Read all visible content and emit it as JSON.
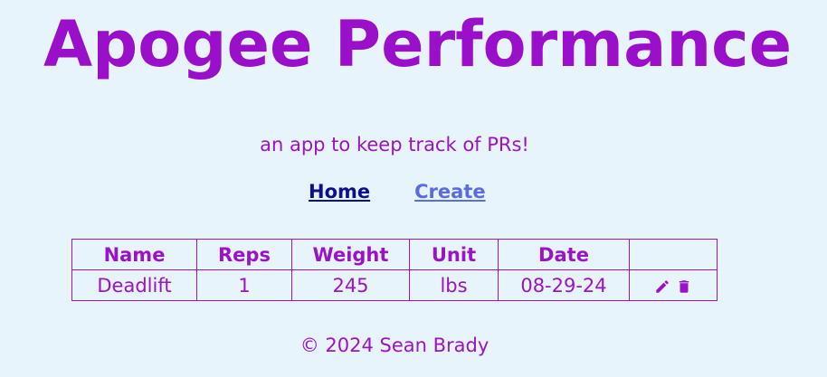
{
  "header": {
    "title": "Apogee Performance",
    "tagline": "an app to keep track of PRs!"
  },
  "nav": {
    "home_label": "Home",
    "create_label": "Create"
  },
  "table": {
    "columns": [
      "Name",
      "Reps",
      "Weight",
      "Unit",
      "Date",
      ""
    ],
    "rows": [
      {
        "name": "Deadlift",
        "reps": "1",
        "weight": "245",
        "unit": "lbs",
        "date": "08-29-24"
      }
    ],
    "row_icons": [
      "pencil-icon",
      "trash-icon"
    ]
  },
  "footer": {
    "text": "© 2024 Sean Brady"
  },
  "colors": {
    "background": "#e8f4fb",
    "accent": "#9a13c6",
    "link_visited": "#0b1091",
    "link": "#5b6ce0"
  }
}
